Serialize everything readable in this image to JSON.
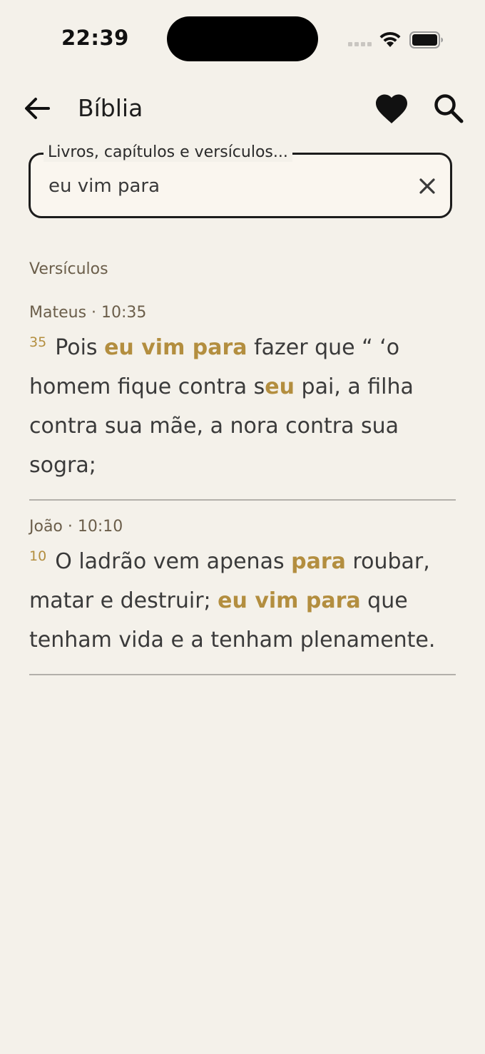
{
  "status_bar": {
    "time": "22:39"
  },
  "app_bar": {
    "title": "Bíblia",
    "icons": {
      "back": "arrow-left-icon",
      "favorite": "heart-icon",
      "search": "search-icon"
    }
  },
  "search": {
    "label": "Livros, capítulos e versículos...",
    "value": "eu vim para"
  },
  "results": {
    "heading": "Versículos",
    "items": [
      {
        "reference": "Mateus · 10:35",
        "verse_number": "35",
        "segments": [
          {
            "text": "Pois ",
            "highlight": false
          },
          {
            "text": "eu vim para",
            "highlight": true
          },
          {
            "text": " fazer que “ ‘o homem fique contra s",
            "highlight": false
          },
          {
            "text": "eu",
            "highlight": true
          },
          {
            "text": " pai, a filha contra sua mãe, a nora contra sua sogra;",
            "highlight": false
          }
        ]
      },
      {
        "reference": "João · 10:10",
        "verse_number": "10",
        "segments": [
          {
            "text": "O ladrão vem apenas ",
            "highlight": false
          },
          {
            "text": "para",
            "highlight": true
          },
          {
            "text": " roubar, matar e destruir; ",
            "highlight": false
          },
          {
            "text": "eu vim para",
            "highlight": true
          },
          {
            "text": " que tenham vida e a tenham plenamente.",
            "highlight": false
          }
        ]
      }
    ]
  },
  "colors": {
    "background": "#f4f1ea",
    "highlight": "#b38e3f",
    "text": "#3a3a3a",
    "muted": "#6b5e4a"
  }
}
